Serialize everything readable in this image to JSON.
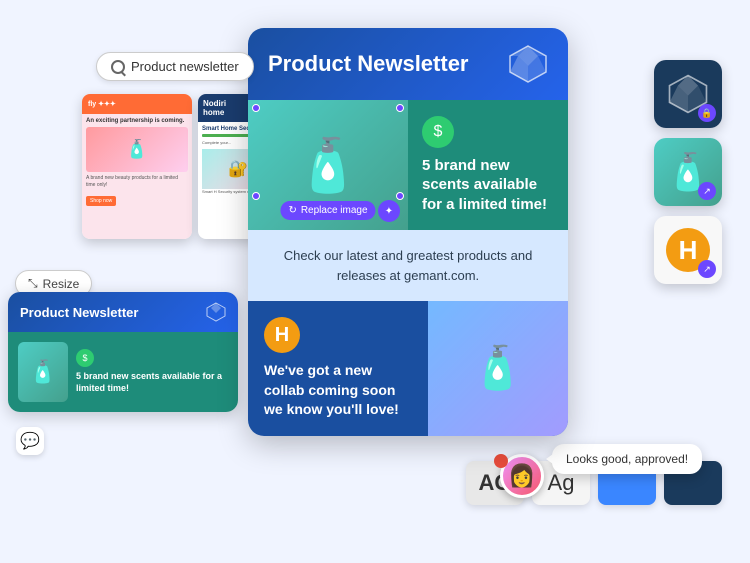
{
  "search": {
    "placeholder": "Product newsletter",
    "value": "Product newsletter"
  },
  "main_card": {
    "title": "Product Newsletter",
    "section1": {
      "scent_text": "5 brand new scents available for a limited time!",
      "replace_btn": "Replace image"
    },
    "section2": {
      "text": "Check our latest and greatest products and releases at gemant.com."
    },
    "section3": {
      "collab_text": "We've got a new collab coming soon we know you'll love!",
      "collab_letter": "H"
    }
  },
  "resize_btn": "Resize",
  "preview_card": {
    "title": "Product Newsletter",
    "scent_text": "5 brand new scents available for a limited time!"
  },
  "tooltip": {
    "text": "Looks good, approved!"
  },
  "font_labels": {
    "ag1": "AG",
    "ag2": "Ag"
  },
  "icons": {
    "search": "🔍",
    "gem": "◈",
    "spray": "🧴",
    "spray2": "🧴",
    "dollar": "$",
    "h_letter": "H",
    "lock": "🔒",
    "share": "↗",
    "chat": "💬",
    "avatar": "👩",
    "refresh": "↻"
  }
}
